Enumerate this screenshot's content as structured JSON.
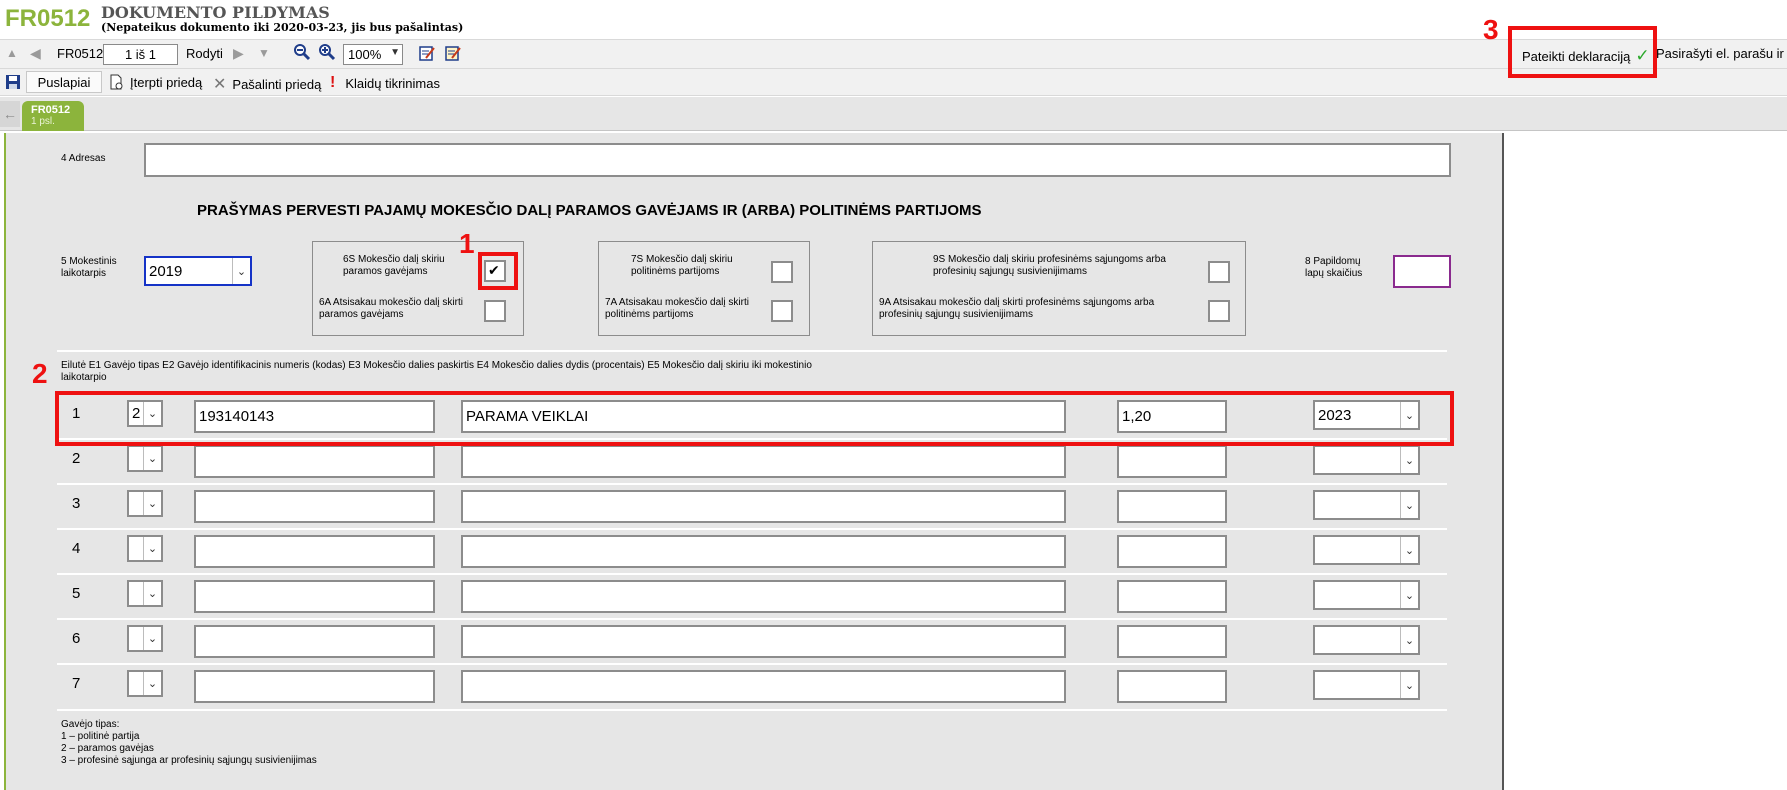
{
  "header": {
    "code": "FR0512",
    "title": "DOKUMENTO PILDYMAS",
    "subtitle": "(Nepateikus dokumento iki 2020-03-23, jis bus pašalintas)"
  },
  "toolbar1": {
    "form_code": "FR0512",
    "page_value": "1 iš 1",
    "show_label": "Rodyti",
    "zoom_value": "100%",
    "submit_label": "Pateikti deklaraciją",
    "sign_label": "Pasirašyti el. parašu ir pa"
  },
  "toolbar2": {
    "pages_label": "Puslapiai",
    "insert_label": "Įterpti priedą",
    "remove_label": "Pašalinti priedą",
    "errors_label": "Klaidų tikrinimas"
  },
  "tab": {
    "code": "FR0512",
    "page": "1 psl."
  },
  "form": {
    "address_label": "4 Adresas",
    "address_value": "",
    "heading": "PRAŠYMAS PERVESTI PAJAMŲ MOKESČIO DALĮ PARAMOS GAVĖJAMS IR (ARBA) POLITINĖMS PARTIJOMS",
    "period_label": "5 Mokestinis laikotarpis",
    "period_value": "2019",
    "g6s_label": "6S Mokesčio dalį skiriu paramos gavėjams",
    "g6a_label": "6A Atsisakau mokesčio dalį skirti paramos gavėjams",
    "g7s_label": "7S Mokesčio dalį skiriu politinėms partijoms",
    "g7a_label": "7A Atsisakau mokesčio dalį skirti politinėms partijoms",
    "g9s_label": "9S Mokesčio dalį skiriu profesinėms sąjungoms arba profesinių sąjungų susivienijimams",
    "g9a_label": "9A Atsisakau mokesčio dalį skirti profesinėms sąjungoms arba profesinių sąjungų susivienijimams",
    "extra_pages_label": "8 Papildomų lapų skaičius",
    "extra_pages_value": "",
    "table_header": "Eilutė E1 Gavėjo tipas E2 Gavėjo identifikacinis numeris (kodas) E3 Mokesčio dalies paskirtis E4 Mokesčio dalies dydis (procentais) E5 Mokesčio dalį skiriu iki mokestinio laikotarpio",
    "rows": [
      {
        "num": "1",
        "type": "2",
        "id": "193140143",
        "purpose": "PARAMA VEIKLAI",
        "pct": "1,20",
        "year": "2023"
      },
      {
        "num": "2",
        "type": "",
        "id": "",
        "purpose": "",
        "pct": "",
        "year": ""
      },
      {
        "num": "3",
        "type": "",
        "id": "",
        "purpose": "",
        "pct": "",
        "year": ""
      },
      {
        "num": "4",
        "type": "",
        "id": "",
        "purpose": "",
        "pct": "",
        "year": ""
      },
      {
        "num": "5",
        "type": "",
        "id": "",
        "purpose": "",
        "pct": "",
        "year": ""
      },
      {
        "num": "6",
        "type": "",
        "id": "",
        "purpose": "",
        "pct": "",
        "year": ""
      },
      {
        "num": "7",
        "type": "",
        "id": "",
        "purpose": "",
        "pct": "",
        "year": ""
      }
    ],
    "legend": [
      "Gavėjo tipas:",
      "1 – politinė partija",
      "2 – paramos gavėjas",
      "3 – profesinė sąjunga ar profesinių sąjungų susivienijimas"
    ]
  },
  "annotations": {
    "n1": "1",
    "n2": "2",
    "n3": "3",
    "color": "#ee1111"
  },
  "colors": {
    "brand": "#8cb43c",
    "annotation": "#ee1111"
  }
}
